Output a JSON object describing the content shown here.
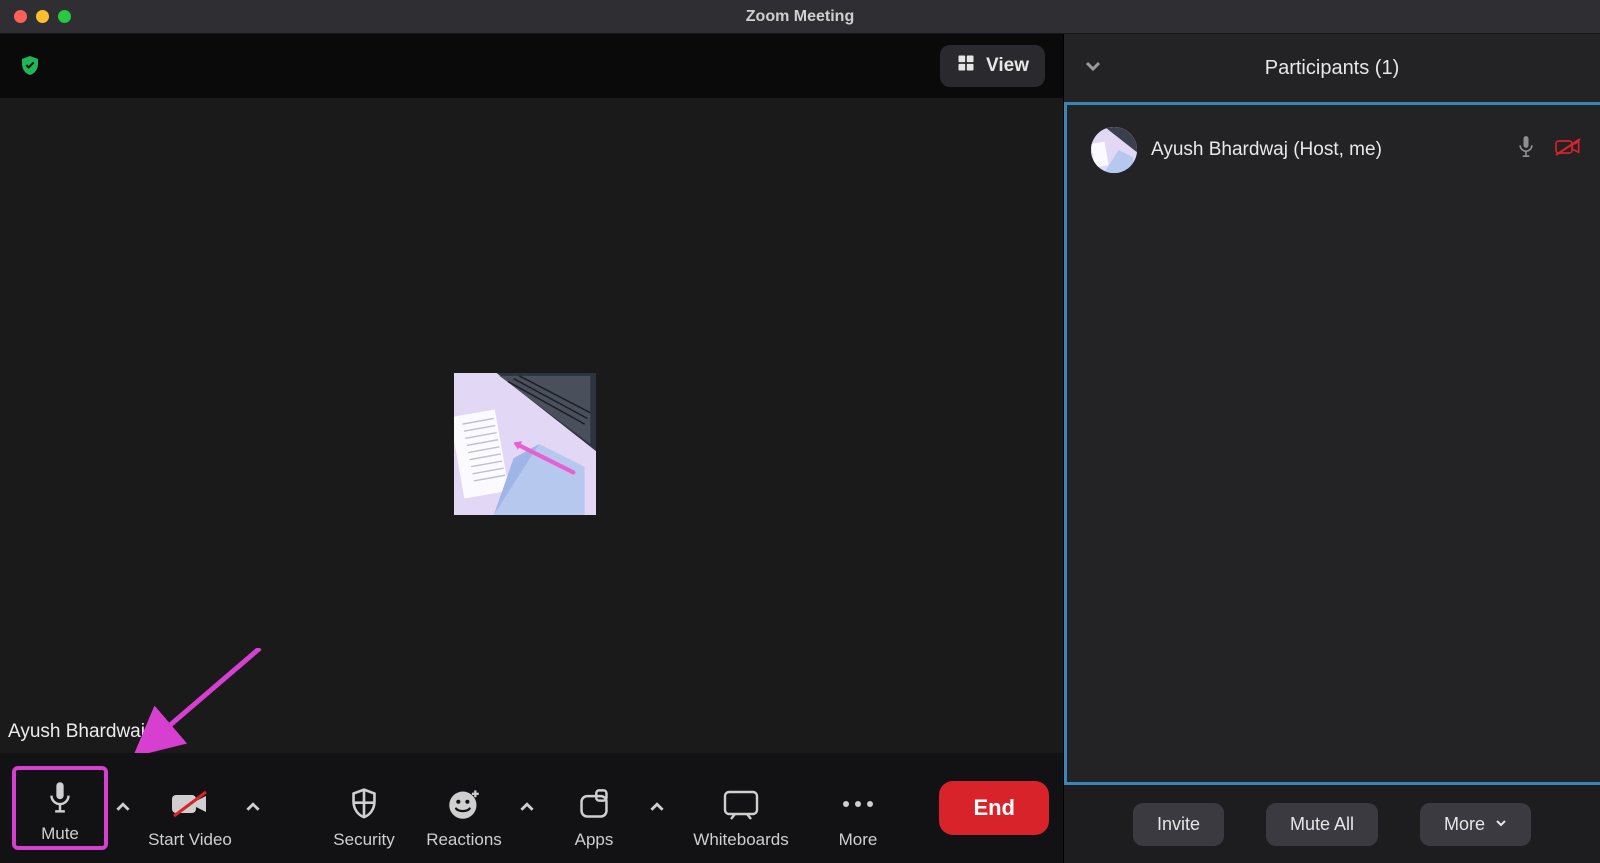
{
  "window": {
    "title": "Zoom Meeting"
  },
  "topbar": {
    "view_label": "View"
  },
  "stage": {
    "self_name": "Ayush Bhardwaj"
  },
  "toolbar": {
    "mute": "Mute",
    "start_video": "Start Video",
    "security": "Security",
    "reactions": "Reactions",
    "apps": "Apps",
    "whiteboards": "Whiteboards",
    "more": "More",
    "end": "End"
  },
  "participants": {
    "panel_title": "Participants (1)",
    "list": [
      {
        "name": "Ayush Bhardwaj (Host, me)"
      }
    ],
    "footer": {
      "invite": "Invite",
      "mute_all": "Mute All",
      "more": "More"
    }
  },
  "colors": {
    "annotation": "#d63fcf",
    "panel_highlight": "#3b86b6",
    "end_button": "#d8232a",
    "shield": "#1fb658"
  }
}
